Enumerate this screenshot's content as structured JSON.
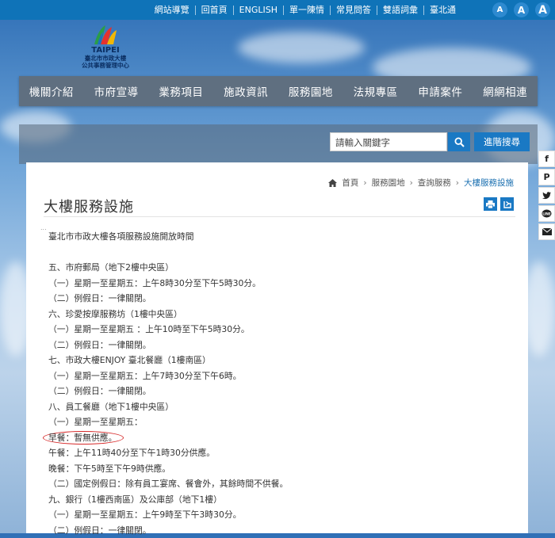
{
  "topbar": {
    "links": [
      "網站導覽",
      "回首頁",
      "ENGLISH",
      "單一陳情",
      "常見問答",
      "雙語詞彙",
      "臺北通"
    ],
    "font_sizes": [
      "A",
      "A",
      "A"
    ]
  },
  "logo": {
    "name": "TAIPEI",
    "org_line1": "臺北市市政大樓",
    "org_line2": "公共事務管理中心"
  },
  "nav": [
    "機關介紹",
    "市府宣導",
    "業務項目",
    "施政資訊",
    "服務園地",
    "法規專區",
    "申請案件",
    "網網相連"
  ],
  "search": {
    "placeholder": "請輸入關鍵字",
    "advanced_label": "進階搜尋"
  },
  "social": [
    "f",
    "P",
    "twitter-icon",
    "LINE",
    "mail-icon"
  ],
  "breadcrumb": {
    "home": "首頁",
    "items": [
      "服務園地",
      "查詢服務"
    ],
    "current": "大樓服務設施"
  },
  "page": {
    "title": "大樓服務設施",
    "intro": "臺北市市政大樓各項服務設施開放時間"
  },
  "content": {
    "lines": [
      "五、市府郵局（地下2樓中央區）",
      "（一）星期一至星期五：上午8時30分至下午5時30分。",
      "（二）例假日：一律關閉。",
      "六、珍愛按摩服務坊（1樓中央區）",
      "（一）星期一至星期五 ：上午10時至下午5時30分。",
      "（二）例假日：一律關閉。",
      "七、市政大樓ENJOY 臺北餐廳（1樓南區）",
      "（一）星期一至星期五：上午7時30分至下午6時。",
      "（二）例假日：一律關閉。",
      "八、員工餐廳（地下1樓中央區）",
      "（一）星期一至星期五："
    ],
    "breakfast": "早餐：暫無供應。",
    "lines2": [
      "午餐：上午11時40分至下午1時30分供應。",
      "晚餐：下午5時至下午9時供應。",
      "（二）國定例假日：除有員工宴席、餐會外，其餘時間不供餐。",
      "九、銀行（1樓西南區）及公庫部（地下1樓）",
      "（一）星期一至星期五：上午9時至下午3時30分。",
      "（二）例假日：一律關閉。"
    ]
  },
  "colors": {
    "topbar": "#0f73b8",
    "nav": "#5f6f80",
    "accent": "#1a79c4",
    "highlight_circle": "#d62a2a"
  }
}
